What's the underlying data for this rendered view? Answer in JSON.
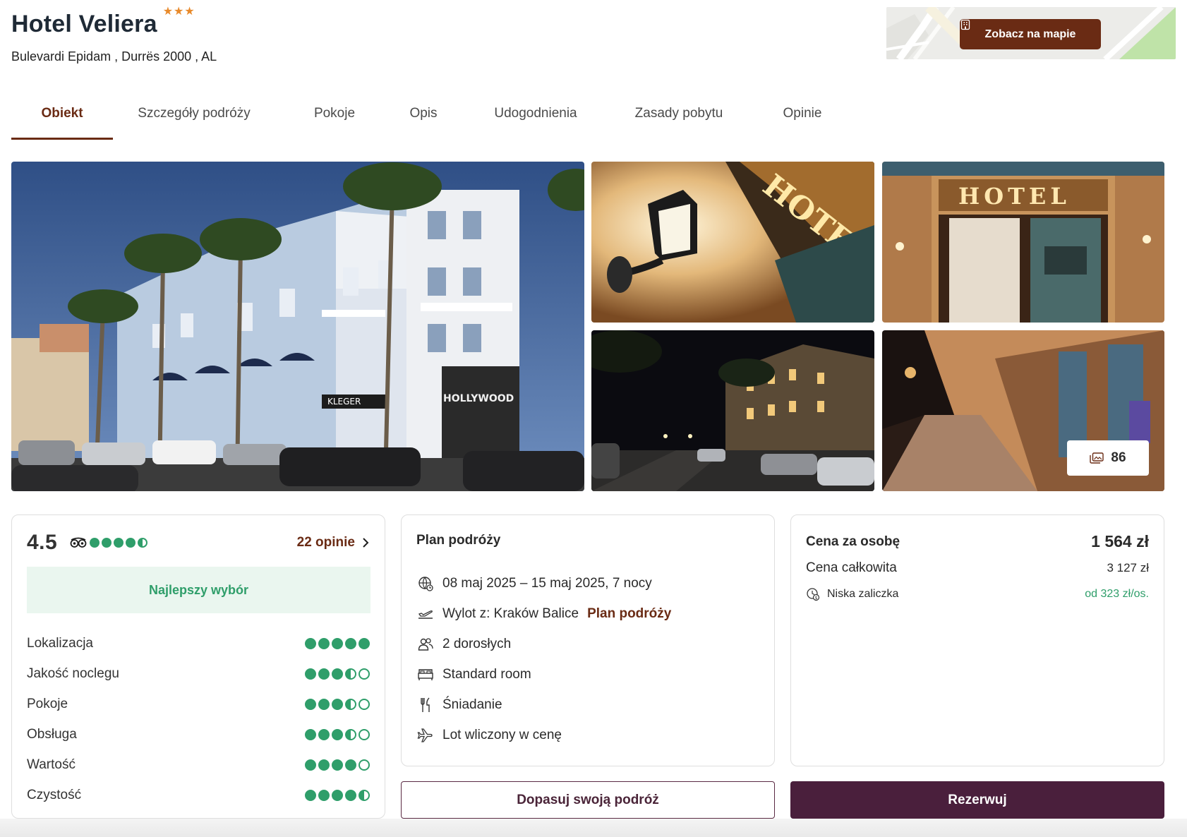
{
  "header": {
    "hotel_name": "Hotel Veliera",
    "stars": [
      "★",
      "★",
      "★"
    ],
    "address": "Bulevardi Epidam , Durrës 2000 , AL",
    "map_button": "Zobacz na mapie"
  },
  "tabs": [
    {
      "label": "Obiekt",
      "active": true
    },
    {
      "label": "Szczegóły podróży"
    },
    {
      "label": "Pokoje"
    },
    {
      "label": "Opis"
    },
    {
      "label": "Udogodnienia"
    },
    {
      "label": "Zasady pobytu"
    },
    {
      "label": "Opinie"
    }
  ],
  "gallery": {
    "photo_count": "86",
    "photo_count_icon": "images-icon",
    "main_sign_1": "HOLLYWOOD",
    "main_sign_2": "KLEGER",
    "hotel_sign": "HOTEL"
  },
  "rating": {
    "score": "4.5",
    "score_dots": 4.5,
    "reviews_link": "22 opinie",
    "badge": "Najlepszy wybór",
    "categories": [
      {
        "label": "Lokalizacja",
        "value": 5
      },
      {
        "label": "Jakość noclegu",
        "value": 3.5
      },
      {
        "label": "Pokoje",
        "value": 3.5
      },
      {
        "label": "Obsługa",
        "value": 3.5
      },
      {
        "label": "Wartość",
        "value": 4
      },
      {
        "label": "Czystość",
        "value": 4.5
      }
    ],
    "accent_color": "#2f9e6a"
  },
  "plan": {
    "title": "Plan podróży",
    "dates": "08 maj 2025 – 15 maj 2025, 7 nocy",
    "flight_from": "Wylot z: Kraków Balice",
    "flight_link": "Plan podróży",
    "guests": "2 dorosłych",
    "room": "Standard room",
    "board": "Śniadanie",
    "flight_included": "Lot wliczony w cenę"
  },
  "price": {
    "per_person_label": "Cena za osobę",
    "per_person_value": "1 564 zł",
    "total_label": "Cena całkowita",
    "total_value": "3 127 zł",
    "deposit_label": "Niska zaliczka",
    "deposit_value": "od 323 zł/os."
  },
  "buttons": {
    "customize": "Dopasuj swoją podróż",
    "book": "Rezerwuj"
  },
  "colors": {
    "brand_brown": "#6a2b14",
    "brand_plum": "#4a1f3c",
    "star_orange": "#e88a2b"
  }
}
